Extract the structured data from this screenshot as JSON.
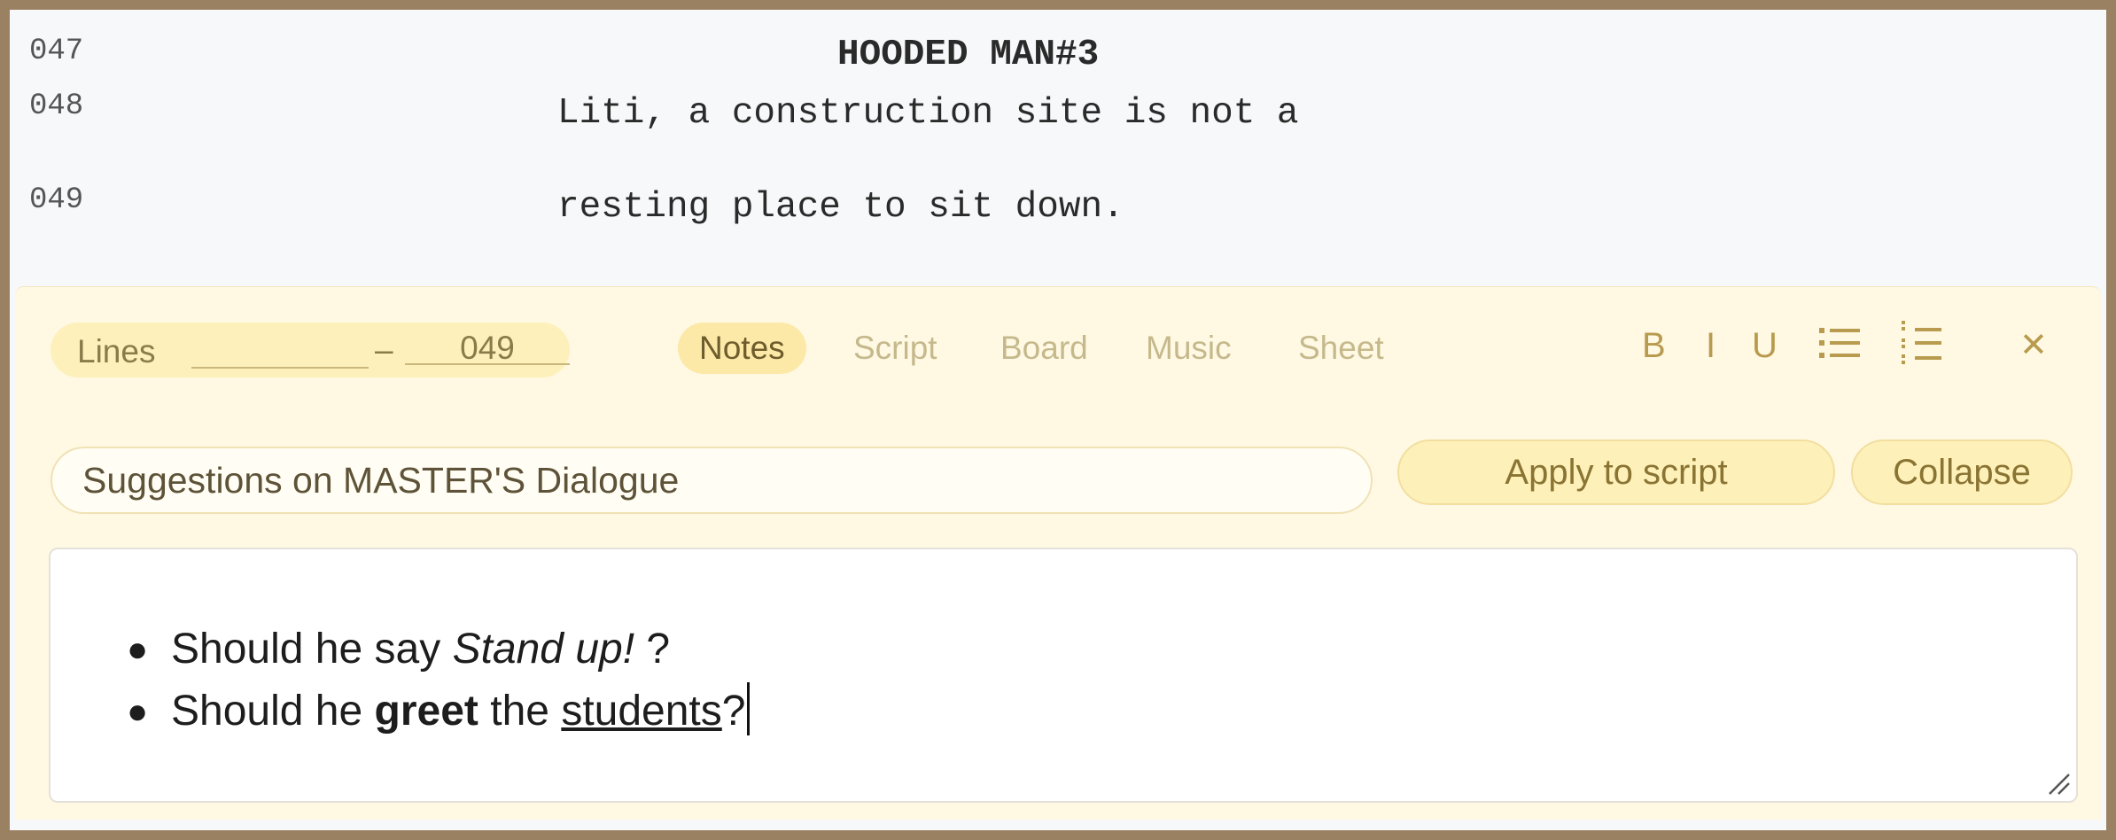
{
  "script": {
    "lines": [
      {
        "number": "047",
        "text": "HOODED MAN#3"
      },
      {
        "number": "048",
        "text": "Liti, a construction site is not a"
      },
      {
        "number": "049",
        "text": "resting place to sit down."
      }
    ]
  },
  "panel": {
    "lines_label": "Lines",
    "lines_separator": "–",
    "lines_to": "049",
    "tabs": [
      {
        "label": "Notes",
        "active": true
      },
      {
        "label": "Script",
        "active": false
      },
      {
        "label": "Board",
        "active": false
      },
      {
        "label": "Music",
        "active": false
      },
      {
        "label": "Sheet",
        "active": false
      }
    ],
    "format": {
      "bold": "B",
      "italic": "I",
      "underline": "U",
      "bullet_list_icon": "bullet-list-icon",
      "numbered_list_icon": "numbered-list-icon",
      "close": "✕"
    },
    "subject": "Suggestions on MASTER'S Dialogue",
    "apply_label": "Apply to script",
    "collapse_label": "Collapse",
    "notes": {
      "item1": {
        "prefix": "Should he say ",
        "italic": "Stand up!",
        "suffix": " ?"
      },
      "item2": {
        "prefix": "Should he ",
        "bold": "greet",
        "middle": " the ",
        "underline": "students",
        "suffix": "?"
      }
    }
  },
  "colors": {
    "frame": "#9a8161",
    "panel_bg": "#fff9e4",
    "accent": "#fce9a8",
    "icon": "#b89b4e"
  }
}
